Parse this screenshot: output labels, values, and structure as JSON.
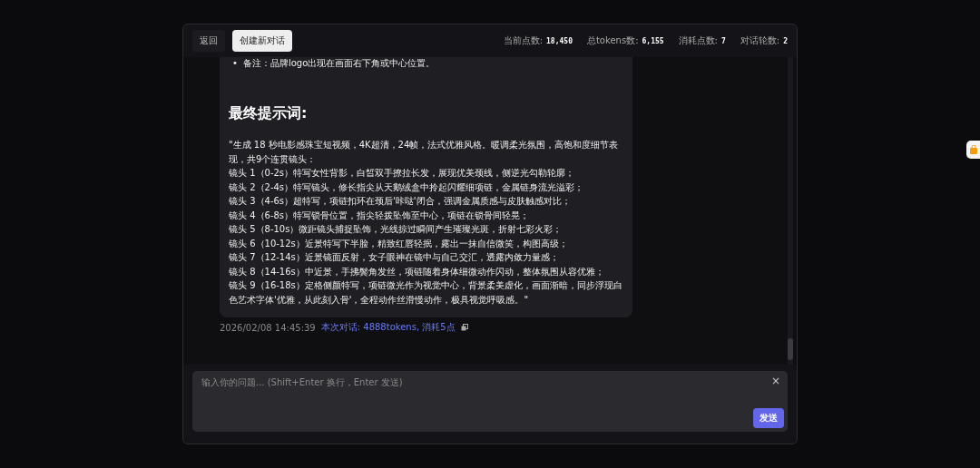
{
  "header": {
    "back_button": "返回",
    "new_chat_button": "创建新对话",
    "stats": [
      {
        "label": "当前点数:",
        "value": "18,450"
      },
      {
        "label": "总tokens数:",
        "value": "6,155"
      },
      {
        "label": "消耗点数:",
        "value": "7"
      },
      {
        "label": "对话轮数:",
        "value": "2"
      }
    ]
  },
  "message": {
    "bullets": [
      {
        "marker": "•",
        "text": "备注：品牌logo出现在画面右下角或中心位置。"
      }
    ],
    "heading": "最终提示词:",
    "paragraphs": [
      "\"生成 18 秒电影感珠宝短视频，4K超清，24帧，法式优雅风格。暖调柔光氛围，高饱和度细节表现，共9个连贯镜头：",
      "镜头 1（0-2s）特写女性背影，白皙双手撩拉长发，展现优美颈线，侧逆光勾勒轮廓；",
      "镜头 2（2-4s）特写镜头，修长指尖从天鹅绒盒中拎起闪耀细项链，金属链身流光溢彩；",
      "镜头 3（4-6s）超特写，项链扣环在颈后'咔哒'闭合，强调金属质感与皮肤触感对比；",
      "镜头 4（6-8s）特写锁骨位置，指尖轻拨坠饰至中心，项链在锁骨间轻晃；",
      "镜头 5（8-10s）微距镜头捕捉坠饰，光线掠过瞬间产生璀璨光斑，折射七彩火彩；",
      "镜头 6（10-12s）近景特写下半脸，精致红唇轻抿，露出一抹自信微笑，构图高级；",
      "镜头 7（12-14s）近景镜面反射，女子眼神在镜中与自己交汇，透露内敛力量感；",
      "镜头 8（14-16s）中近景，手拂鬓角发丝，项链随着身体细微动作闪动，整体氛围从容优雅；",
      "镜头 9（16-18s）定格侧颜特写，项链微光作为视觉中心，背景柔美虚化，画面渐暗，同步浮现白色艺术字体'优雅，从此刻入骨'，全程动作丝滑慢动作，极具视觉呼吸感。\""
    ],
    "timestamp": "2026/02/08 14:45:39",
    "usage": "本次对话: 4888tokens, 消耗5点"
  },
  "input": {
    "placeholder": "输入你的问题... (Shift+Enter 换行，Enter 发送)",
    "close": "×",
    "send_button": "发送"
  }
}
